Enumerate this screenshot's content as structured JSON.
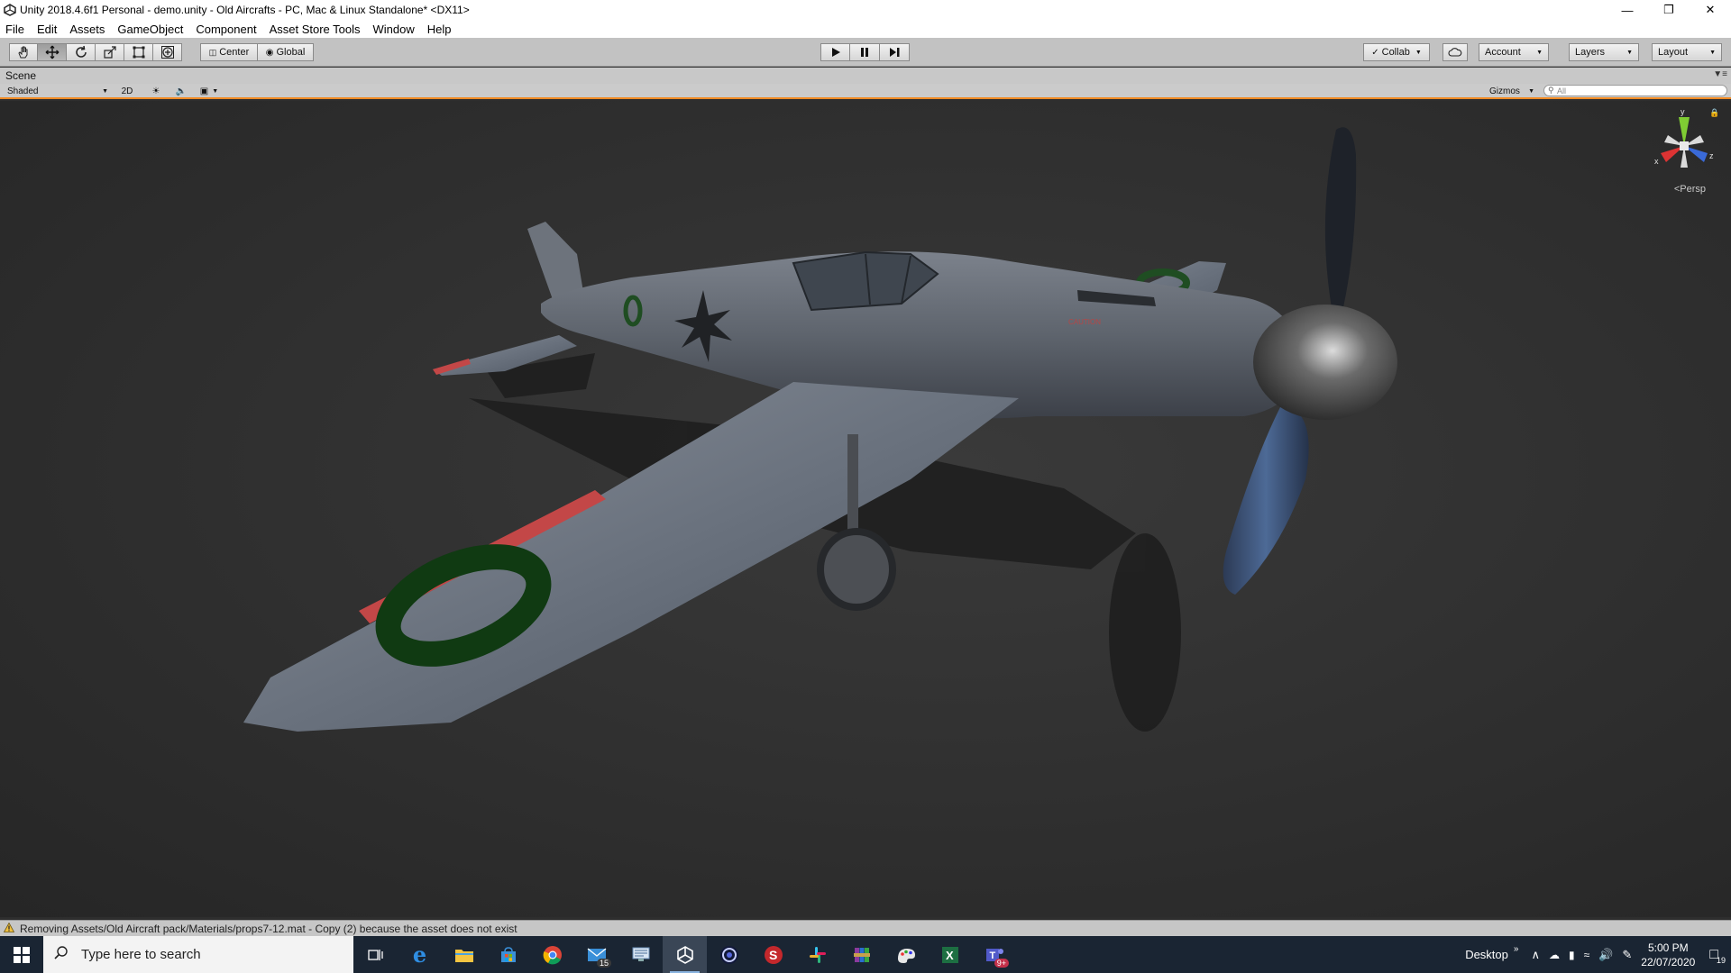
{
  "window": {
    "title": "Unity 2018.4.6f1 Personal - demo.unity - Old Aircrafts - PC, Mac & Linux Standalone* <DX11>",
    "controls": [
      "minimize-icon",
      "restore-icon",
      "close-icon"
    ]
  },
  "menu": [
    "File",
    "Edit",
    "Assets",
    "GameObject",
    "Component",
    "Asset Store Tools",
    "Window",
    "Help"
  ],
  "toolbar": {
    "tools": [
      "hand-tool-icon",
      "move-tool-icon",
      "rotate-tool-icon",
      "scale-tool-icon",
      "rect-tool-icon",
      "transform-tool-icon"
    ],
    "active_tool": "move-tool-icon",
    "pivot_label": "Center",
    "space_label": "Global",
    "play": [
      "play-icon",
      "pause-icon",
      "step-icon"
    ],
    "collab_label": "Collab",
    "account_label": "Account",
    "layers_label": "Layers",
    "layout_label": "Layout"
  },
  "scene": {
    "tab_label": "Scene",
    "shading_mode": "Shaded",
    "mode_2d": "2D",
    "gizmos_label": "Gizmos",
    "search_placeholder": "All",
    "projection_label": "Persp",
    "axis_labels": {
      "y": "y",
      "x": "x",
      "z": "z"
    },
    "aircraft_text": "CAUTION"
  },
  "status": {
    "message": "Removing Assets/Old Aircraft pack/Materials/props7-12.mat - Copy (2) because the asset does not exist",
    "icon": "warning-icon"
  },
  "taskbar": {
    "search_placeholder": "Type here to search",
    "apps": [
      {
        "name": "task-view-icon",
        "badge": ""
      },
      {
        "name": "edge-icon",
        "badge": ""
      },
      {
        "name": "file-explorer-icon",
        "badge": ""
      },
      {
        "name": "store-icon",
        "badge": ""
      },
      {
        "name": "chrome-icon",
        "badge": ""
      },
      {
        "name": "mail-icon",
        "badge": "15"
      },
      {
        "name": "remote-desktop-icon",
        "badge": ""
      },
      {
        "name": "unity-icon",
        "badge": ""
      },
      {
        "name": "cinema4d-icon",
        "badge": ""
      },
      {
        "name": "substance-icon",
        "badge": ""
      },
      {
        "name": "slack-icon",
        "badge": ""
      },
      {
        "name": "winrar-icon",
        "badge": ""
      },
      {
        "name": "paint-icon",
        "badge": ""
      },
      {
        "name": "excel-icon",
        "badge": ""
      },
      {
        "name": "teams-icon",
        "badge": "9+"
      }
    ],
    "tray_label": "Desktop",
    "time": "5:00 PM",
    "date": "22/07/2020",
    "notifications": "19"
  },
  "colors": {
    "accent_orange": "#f08a24",
    "viewport_bg": "#2f2f2f",
    "taskbar_bg": "#1a2533"
  }
}
